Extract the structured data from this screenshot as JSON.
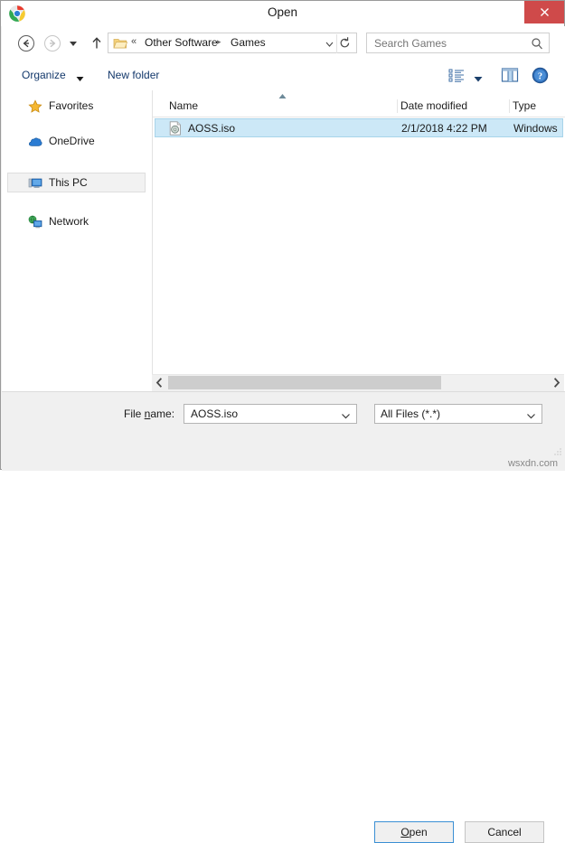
{
  "window": {
    "title": "Open",
    "app_icon": "chrome-logo-icon",
    "close_label": "Close"
  },
  "navbar": {
    "back_label": "Back",
    "forward_label": "Forward",
    "recent_label": "Recent locations",
    "up_label": "Up one level",
    "breadcrumb": {
      "folder_icon": "folder-icon",
      "overflow": "«",
      "parent": "Other Software",
      "separator": "▸",
      "current": "Games",
      "dropdown_icon": "chevron-down-icon",
      "refresh_icon": "refresh-icon"
    },
    "search": {
      "placeholder": "Search Games",
      "value": "",
      "icon": "search-icon"
    }
  },
  "toolbar": {
    "organize_label": "Organize",
    "organize_arrow": "caret-down-icon",
    "new_folder_label": "New folder",
    "view_options_icon": "view-list-icon",
    "view_options_arrow": "caret-down-icon",
    "preview_pane_icon": "preview-pane-icon",
    "help_icon": "help-icon"
  },
  "sidebar": {
    "items": [
      {
        "label": "Favorites",
        "icon": "star-icon",
        "selected": false
      },
      {
        "label": "OneDrive",
        "icon": "cloud-icon",
        "selected": false
      },
      {
        "label": "This PC",
        "icon": "computer-icon",
        "selected": true
      },
      {
        "label": "Network",
        "icon": "network-icon",
        "selected": false
      }
    ]
  },
  "filelist": {
    "columns": [
      {
        "label": "Name"
      },
      {
        "label": "Date modified"
      },
      {
        "label": "Type"
      }
    ],
    "sort": {
      "column": "Name",
      "direction": "ascending",
      "icon": "sort-ascending-icon"
    },
    "rows": [
      {
        "icon": "disc-image-file-icon",
        "name": "AOSS.iso",
        "date_modified": "2/1/2018 4:22 PM",
        "type": "Windows",
        "selected": true
      }
    ],
    "hscroll": {
      "left_arrow": "‹",
      "right_arrow": "›",
      "thumb_percent": 72
    }
  },
  "footer": {
    "file_name_label_pre": "File ",
    "file_name_label_key": "n",
    "file_name_label_post": "ame:",
    "file_name_value": "AOSS.iso",
    "file_name_placeholder": "",
    "filter_value": "All Files (*.*)",
    "open_label_key": "O",
    "open_label_post": "pen",
    "cancel_label": "Cancel",
    "watermark": "wsxdn.com"
  },
  "colors": {
    "close_button": "#cf4a4a",
    "selection": "#cce8f7",
    "selection_border": "#a8d4ea",
    "focus_border": "#3a8fd4",
    "link_text": "#13386b",
    "chrome": "#f0f0f0"
  }
}
